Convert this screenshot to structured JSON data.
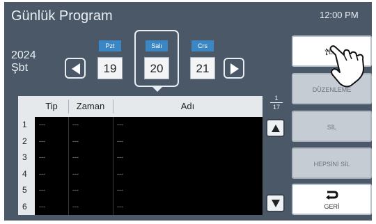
{
  "header": {
    "title": "Günlük Program",
    "clock": "12:00 PM"
  },
  "date": {
    "year": "2024",
    "weekday": "Şbt"
  },
  "days": [
    {
      "label": "Pzt",
      "number": "19"
    },
    {
      "label": "Salı",
      "number": "20"
    },
    {
      "label": "Crs",
      "number": "21"
    }
  ],
  "table": {
    "columns": {
      "tip": "Tip",
      "zaman": "Zaman",
      "adi": "Adı"
    },
    "rows": [
      {
        "num": "1",
        "tip": "---",
        "zaman": "---",
        "adi": "---"
      },
      {
        "num": "2",
        "tip": "---",
        "zaman": "---",
        "adi": "---"
      },
      {
        "num": "3",
        "tip": "---",
        "zaman": "---",
        "adi": "---"
      },
      {
        "num": "4",
        "tip": "---",
        "zaman": "---",
        "adi": "---"
      },
      {
        "num": "5",
        "tip": "---",
        "zaman": "---",
        "adi": "---"
      },
      {
        "num": "6",
        "tip": "---",
        "zaman": "---",
        "adi": "---"
      }
    ],
    "page": {
      "current": "1",
      "total": "17"
    }
  },
  "sidebar": {
    "new": "YENİ",
    "edit": "DÜZENLEME",
    "delete": "SİL",
    "delete_all": "HEPSİNİ SİL",
    "back": "GERİ"
  },
  "icons": {
    "prev": "triangle-left-icon",
    "next": "triangle-right-icon",
    "scroll_up": "triangle-up-icon",
    "scroll_down": "triangle-down-icon",
    "back": "return-arrow-icon",
    "pointer": "hand-pointer-icon"
  },
  "colors": {
    "background": "#4a5868",
    "day_chip": "#3b87c6",
    "table_body": "#000000"
  }
}
